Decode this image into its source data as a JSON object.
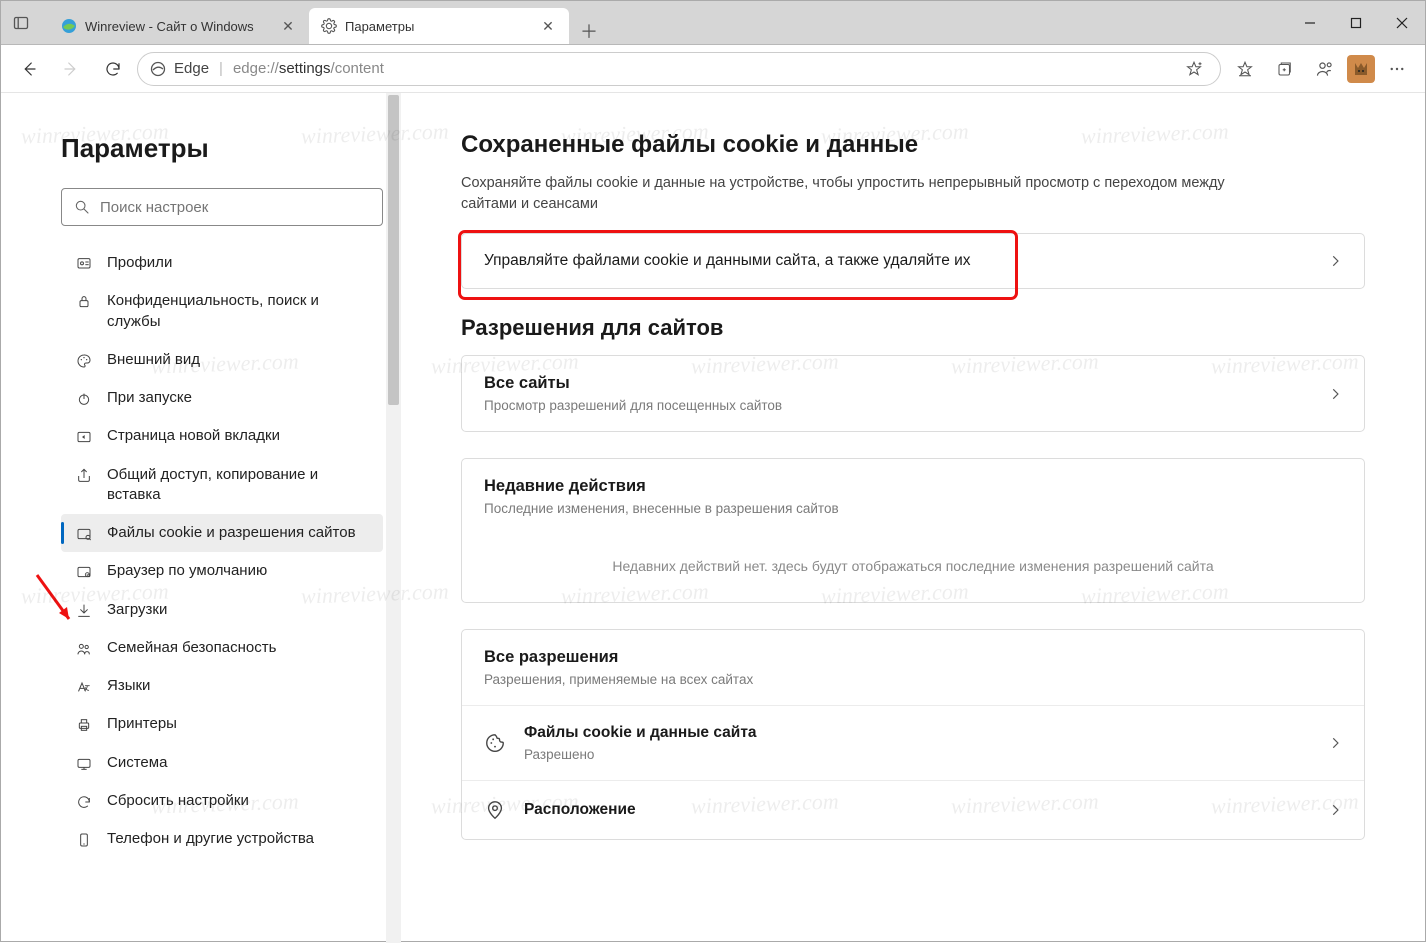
{
  "window": {
    "tabs": [
      {
        "label": "Winreview - Сайт о Windows",
        "active": false
      },
      {
        "label": "Параметры",
        "active": true
      }
    ]
  },
  "toolbar": {
    "url_prefix": "Edge",
    "url_scheme": "edge://",
    "url_path_dark": "settings",
    "url_path_rest": "/content"
  },
  "sidebar": {
    "title": "Параметры",
    "search_placeholder": "Поиск настроек",
    "items": [
      {
        "label": "Профили"
      },
      {
        "label": "Конфиденциальность, поиск и службы"
      },
      {
        "label": "Внешний вид"
      },
      {
        "label": "При запуске"
      },
      {
        "label": "Страница новой вкладки"
      },
      {
        "label": "Общий доступ, копирование и вставка"
      },
      {
        "label": "Файлы cookie и разрешения сайтов"
      },
      {
        "label": "Браузер по умолчанию"
      },
      {
        "label": "Загрузки"
      },
      {
        "label": "Семейная безопасность"
      },
      {
        "label": "Языки"
      },
      {
        "label": "Принтеры"
      },
      {
        "label": "Система"
      },
      {
        "label": "Сбросить настройки"
      },
      {
        "label": "Телефон и другие устройства"
      }
    ]
  },
  "main": {
    "saved": {
      "heading": "Сохраненные файлы cookie и данные",
      "sub": "Сохраняйте файлы cookie и данные на устройстве, чтобы упростить непрерывный просмотр с переходом между сайтами и сеансами",
      "manage_label": "Управляйте файлами cookie и данными сайта, а также удаляйте их"
    },
    "perms": {
      "heading": "Разрешения для сайтов",
      "all_sites_title": "Все сайты",
      "all_sites_sub": "Просмотр разрешений для посещенных сайтов",
      "recent_title": "Недавние действия",
      "recent_sub": "Последние изменения, внесенные в разрешения сайтов",
      "recent_empty": "Недавних действий нет. здесь будут отображаться последние изменения разрешений сайта",
      "all_perms_title": "Все разрешения",
      "all_perms_sub": "Разрешения, применяемые на всех сайтах",
      "cookies_title": "Файлы cookie и данные сайта",
      "cookies_status": "Разрешено",
      "location_title": "Расположение"
    }
  },
  "watermark": "winreviewer.com"
}
